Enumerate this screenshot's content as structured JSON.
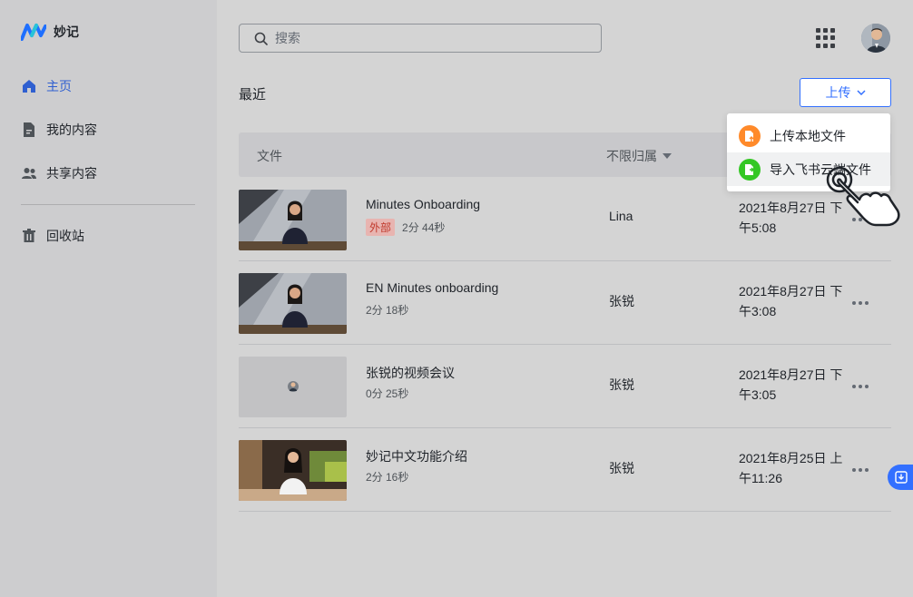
{
  "app": {
    "name": "妙记"
  },
  "sidebar": {
    "items": [
      {
        "label": "主页",
        "icon": "home-icon",
        "active": true
      },
      {
        "label": "我的内容",
        "icon": "document-icon"
      },
      {
        "label": "共享内容",
        "icon": "people-icon"
      },
      {
        "label": "回收站",
        "icon": "trash-icon"
      }
    ]
  },
  "header": {
    "search_placeholder": "搜索"
  },
  "main": {
    "section_title": "最近",
    "upload_label": "上传",
    "columns": {
      "file": "文件",
      "owner": "不限归属"
    },
    "rows": [
      {
        "title": "Minutes Onboarding",
        "tag": "外部",
        "duration": "2分 44秒",
        "owner": "Lina",
        "date": "2021年8月27日 下午5:08"
      },
      {
        "title": "EN Minutes onboarding",
        "duration": "2分 18秒",
        "owner": "张锐",
        "date": "2021年8月27日 下午3:08"
      },
      {
        "title": "张锐的视频会议",
        "duration": "0分 25秒",
        "owner": "张锐",
        "date": "2021年8月27日 下午3:05"
      },
      {
        "title": "妙记中文功能介绍",
        "duration": "2分 16秒",
        "owner": "张锐",
        "date": "2021年8月25日 上午11:26"
      }
    ]
  },
  "dropdown": {
    "items": [
      {
        "label": "上传本地文件",
        "color": "#ff8a2a"
      },
      {
        "label": "导入飞书云端文件",
        "color": "#34c724"
      }
    ]
  },
  "colors": {
    "accent": "#3370ff",
    "tag_text": "#c0392b"
  }
}
